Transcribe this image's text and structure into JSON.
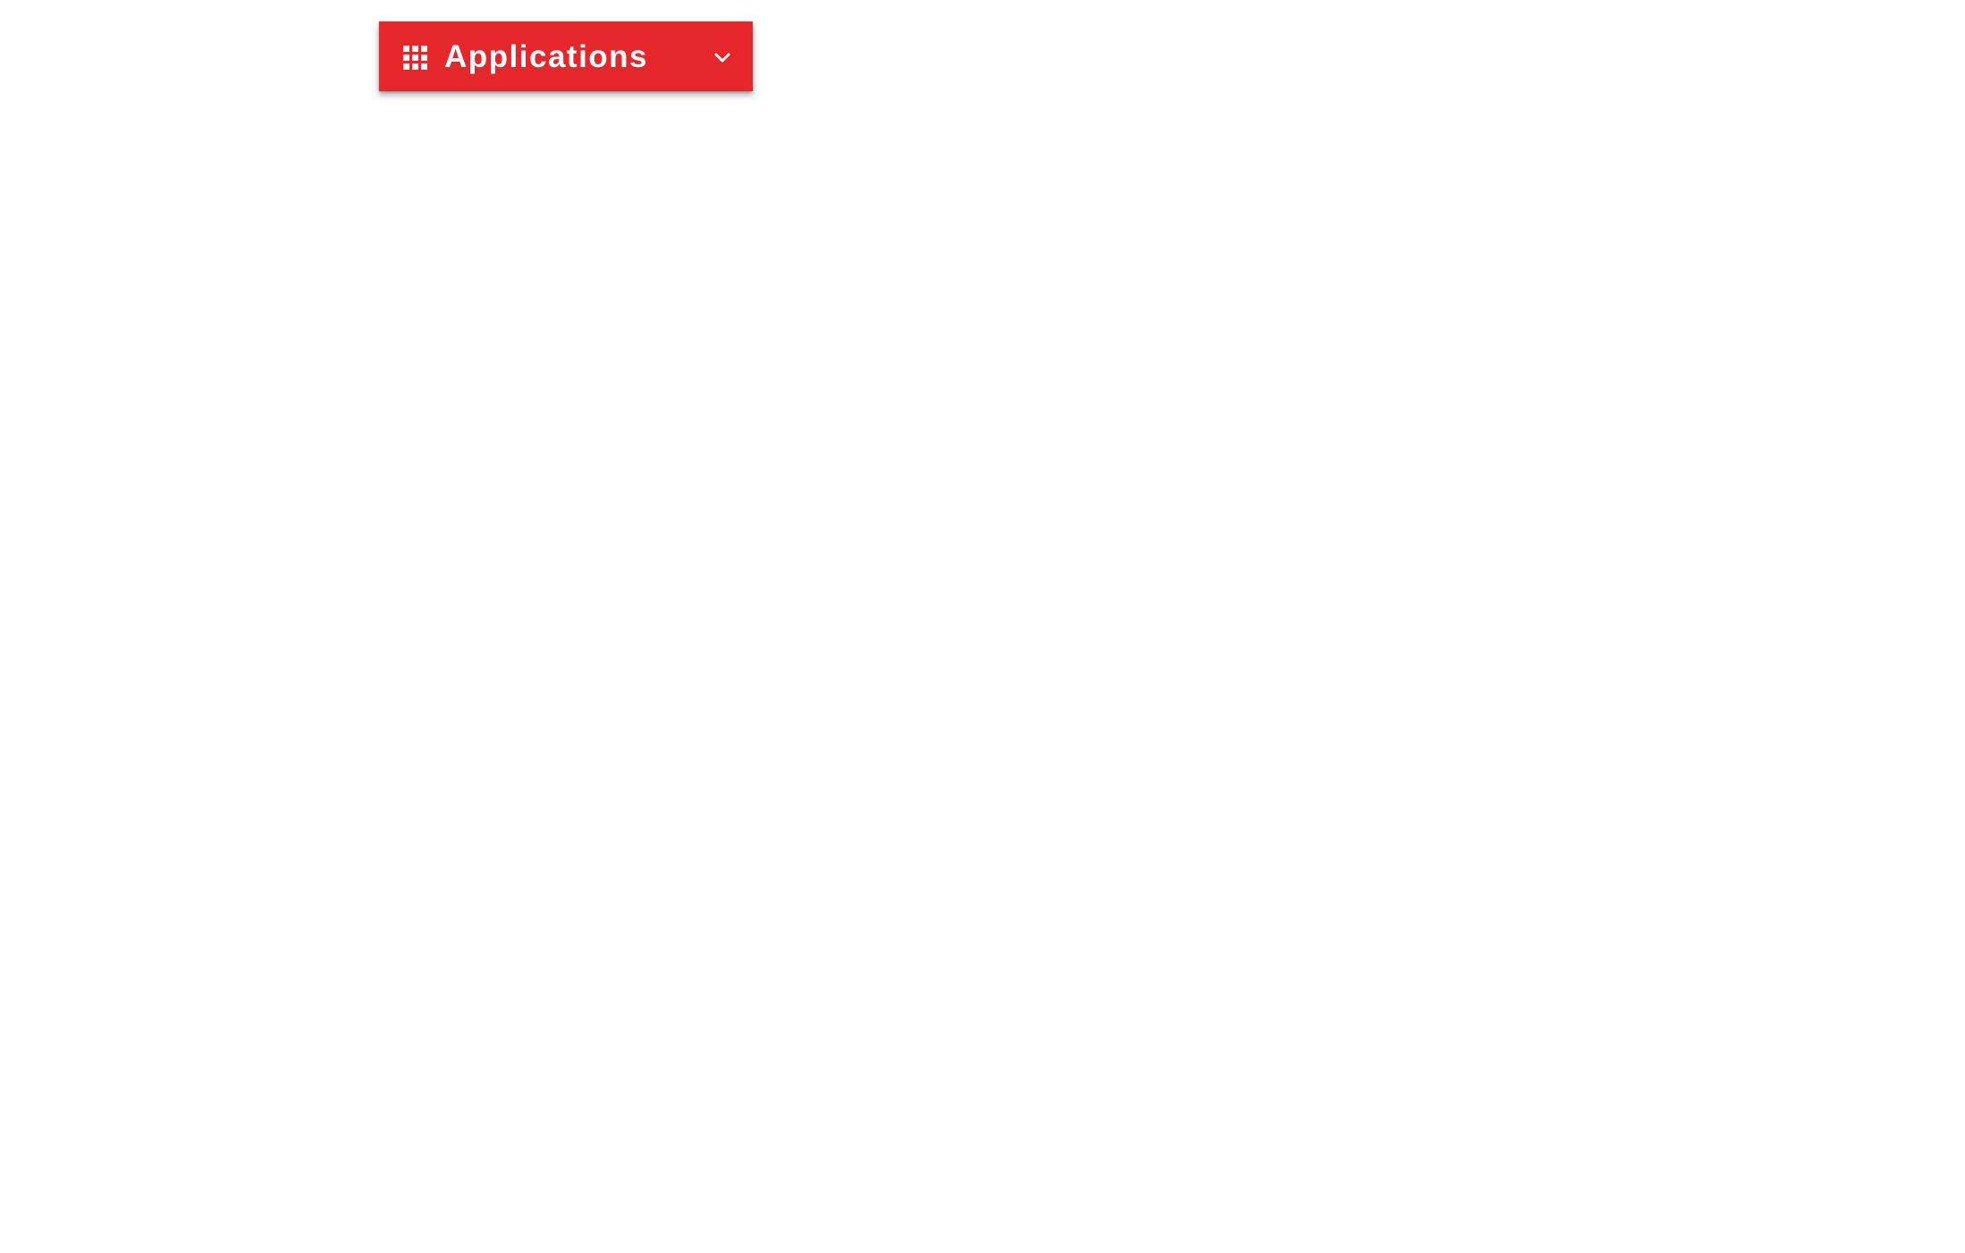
{
  "apps_dropdown": {
    "label": "Applications",
    "icon": "apps-grid-icon",
    "chevron_icon": "chevron-down-icon",
    "background_color": "#e5262a",
    "text_color": "#ffffff"
  }
}
